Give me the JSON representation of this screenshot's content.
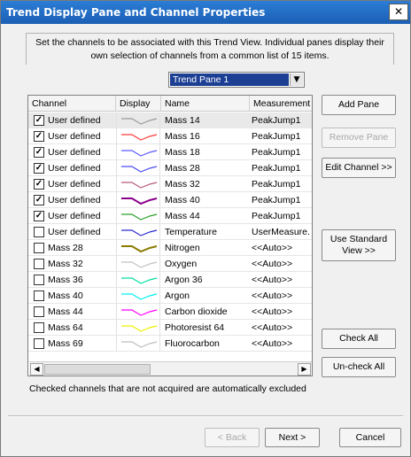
{
  "window": {
    "title": "Trend Display Pane and Channel Properties",
    "close_glyph": "✕"
  },
  "intro_text": "Set the channels to be associated with this Trend View.  Individual panes display their own selection of channels from a common list of 15 items.",
  "pane_select": {
    "value": "Trend Pane 1",
    "arrow_glyph": "▼"
  },
  "grid": {
    "columns": [
      "Channel",
      "Display",
      "Name",
      "Measurement"
    ],
    "rows": [
      {
        "checked": true,
        "channel": "User defined",
        "color": "#9a9a9a",
        "name": "Mass 14",
        "measurement": "PeakJump1"
      },
      {
        "checked": true,
        "channel": "User defined",
        "color": "#ff3b3b",
        "name": "Mass 16",
        "measurement": "PeakJump1"
      },
      {
        "checked": true,
        "channel": "User defined",
        "color": "#5a5aff",
        "name": "Mass 18",
        "measurement": "PeakJump1"
      },
      {
        "checked": true,
        "channel": "User defined",
        "color": "#4a4af0",
        "name": "Mass 28",
        "measurement": "PeakJump1"
      },
      {
        "checked": true,
        "channel": "User defined",
        "color": "#b85a7a",
        "name": "Mass 32",
        "measurement": "PeakJump1"
      },
      {
        "checked": true,
        "channel": "User defined",
        "color": "#8a008a",
        "name": "Mass 40",
        "measurement": "PeakJump1"
      },
      {
        "checked": true,
        "channel": "User defined",
        "color": "#2aa02a",
        "name": "Mass 44",
        "measurement": "PeakJump1"
      },
      {
        "checked": false,
        "channel": "User defined",
        "color": "#2b2bd0",
        "name": "Temperature",
        "measurement": "UserMeasure."
      },
      {
        "checked": false,
        "channel": "Mass 28",
        "color": "#8a7a00",
        "name": "Nitrogen",
        "measurement": "<<Auto>>"
      },
      {
        "checked": false,
        "channel": "Mass 32",
        "color": "#c0c0c0",
        "name": "Oxygen",
        "measurement": "<<Auto>>"
      },
      {
        "checked": false,
        "channel": "Mass 36",
        "color": "#00e0a0",
        "name": "Argon 36",
        "measurement": "<<Auto>>"
      },
      {
        "checked": false,
        "channel": "Mass 40",
        "color": "#00f0f0",
        "name": "Argon",
        "measurement": "<<Auto>>"
      },
      {
        "checked": false,
        "channel": "Mass 44",
        "color": "#ff00ff",
        "name": "Carbon dioxide",
        "measurement": "<<Auto>>"
      },
      {
        "checked": false,
        "channel": "Mass 64",
        "color": "#f0f000",
        "name": "Photoresist 64",
        "measurement": "<<Auto>>"
      },
      {
        "checked": false,
        "channel": "Mass 69",
        "color": "#bdbdbd",
        "name": "Fluorocarbon",
        "measurement": "<<Auto>>"
      }
    ],
    "check_glyph": "✓",
    "scroll_left_glyph": "◀",
    "scroll_right_glyph": "▶"
  },
  "side_buttons": {
    "add_pane": "Add Pane",
    "remove_pane": "Remove Pane",
    "edit_channel": "Edit Channel >>",
    "use_standard_view": "Use Standard View >>",
    "check_all": "Check All",
    "uncheck_all": "Un-check All"
  },
  "note": "Checked channels that are not acquired are automatically excluded",
  "footer_buttons": {
    "back": "< Back",
    "next": "Next >",
    "cancel": "Cancel"
  }
}
